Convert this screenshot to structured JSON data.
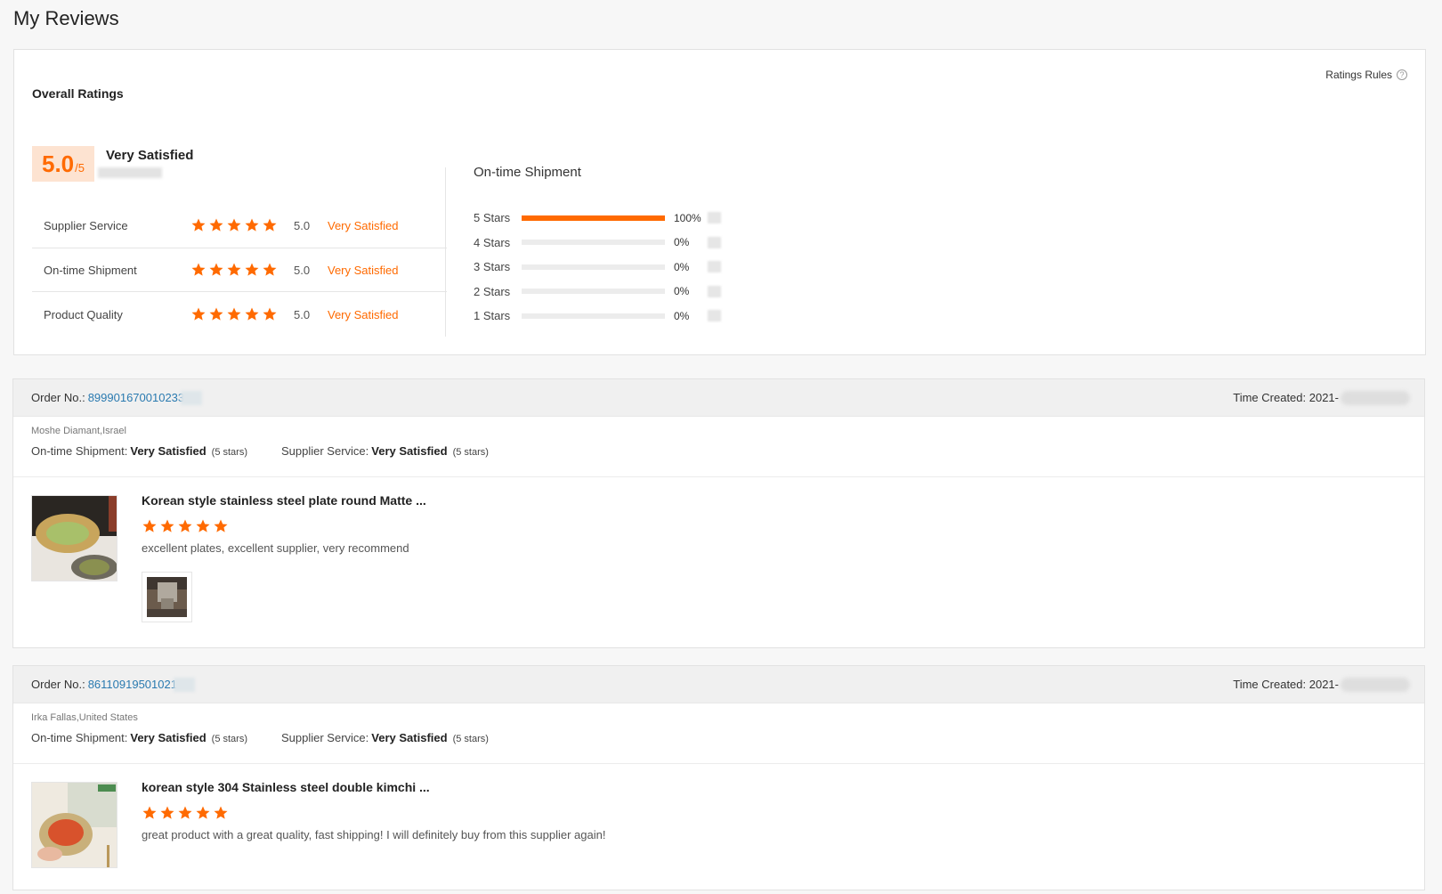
{
  "page": {
    "title": "My Reviews"
  },
  "overall": {
    "title": "Overall Ratings",
    "rules_label": "Ratings Rules",
    "score": "5.0",
    "score_max": "/5",
    "score_text": "Very Satisfied",
    "metrics": [
      {
        "label": "Supplier Service",
        "stars": 5,
        "score": "5.0",
        "status": "Very Satisfied"
      },
      {
        "label": "On-time Shipment",
        "stars": 5,
        "score": "5.0",
        "status": "Very Satisfied"
      },
      {
        "label": "Product Quality",
        "stars": 5,
        "score": "5.0",
        "status": "Very Satisfied"
      }
    ]
  },
  "distribution": {
    "title": "On-time Shipment",
    "rows": [
      {
        "label": "5  Stars",
        "percent": 100,
        "percent_label": "100%"
      },
      {
        "label": "4  Stars",
        "percent": 0,
        "percent_label": "0%"
      },
      {
        "label": "3  Stars",
        "percent": 0,
        "percent_label": "0%"
      },
      {
        "label": "2  Stars",
        "percent": 0,
        "percent_label": "0%"
      },
      {
        "label": "1  Stars",
        "percent": 0,
        "percent_label": "0%"
      }
    ]
  },
  "orders": [
    {
      "order_no_label": "Order No.:",
      "order_no": "899901670010233",
      "time_label": "Time Created: 2021-",
      "buyer": "Moshe Diamant,Israel",
      "shipment_label": "On-time Shipment:",
      "shipment_value": "Very Satisfied",
      "shipment_stars": "(5 stars)",
      "service_label": "Supplier Service:",
      "service_value": "Very Satisfied",
      "service_stars": "(5 stars)",
      "product_name": "Korean style stainless steel plate round Matte ...",
      "rating": 5,
      "review_text": "excellent plates, excellent supplier, very recommend"
    },
    {
      "order_no_label": "Order No.:",
      "order_no": "86110919501021",
      "time_label": "Time Created: 2021-",
      "buyer": "Irka Fallas,United States",
      "shipment_label": "On-time Shipment:",
      "shipment_value": "Very Satisfied",
      "shipment_stars": "(5 stars)",
      "service_label": "Supplier Service:",
      "service_value": "Very Satisfied",
      "service_stars": "(5 stars)",
      "product_name": "korean style 304 Stainless steel double kimchi ...",
      "rating": 5,
      "review_text": "great product with a great quality, fast shipping! I will definitely buy from this supplier again!"
    }
  ]
}
